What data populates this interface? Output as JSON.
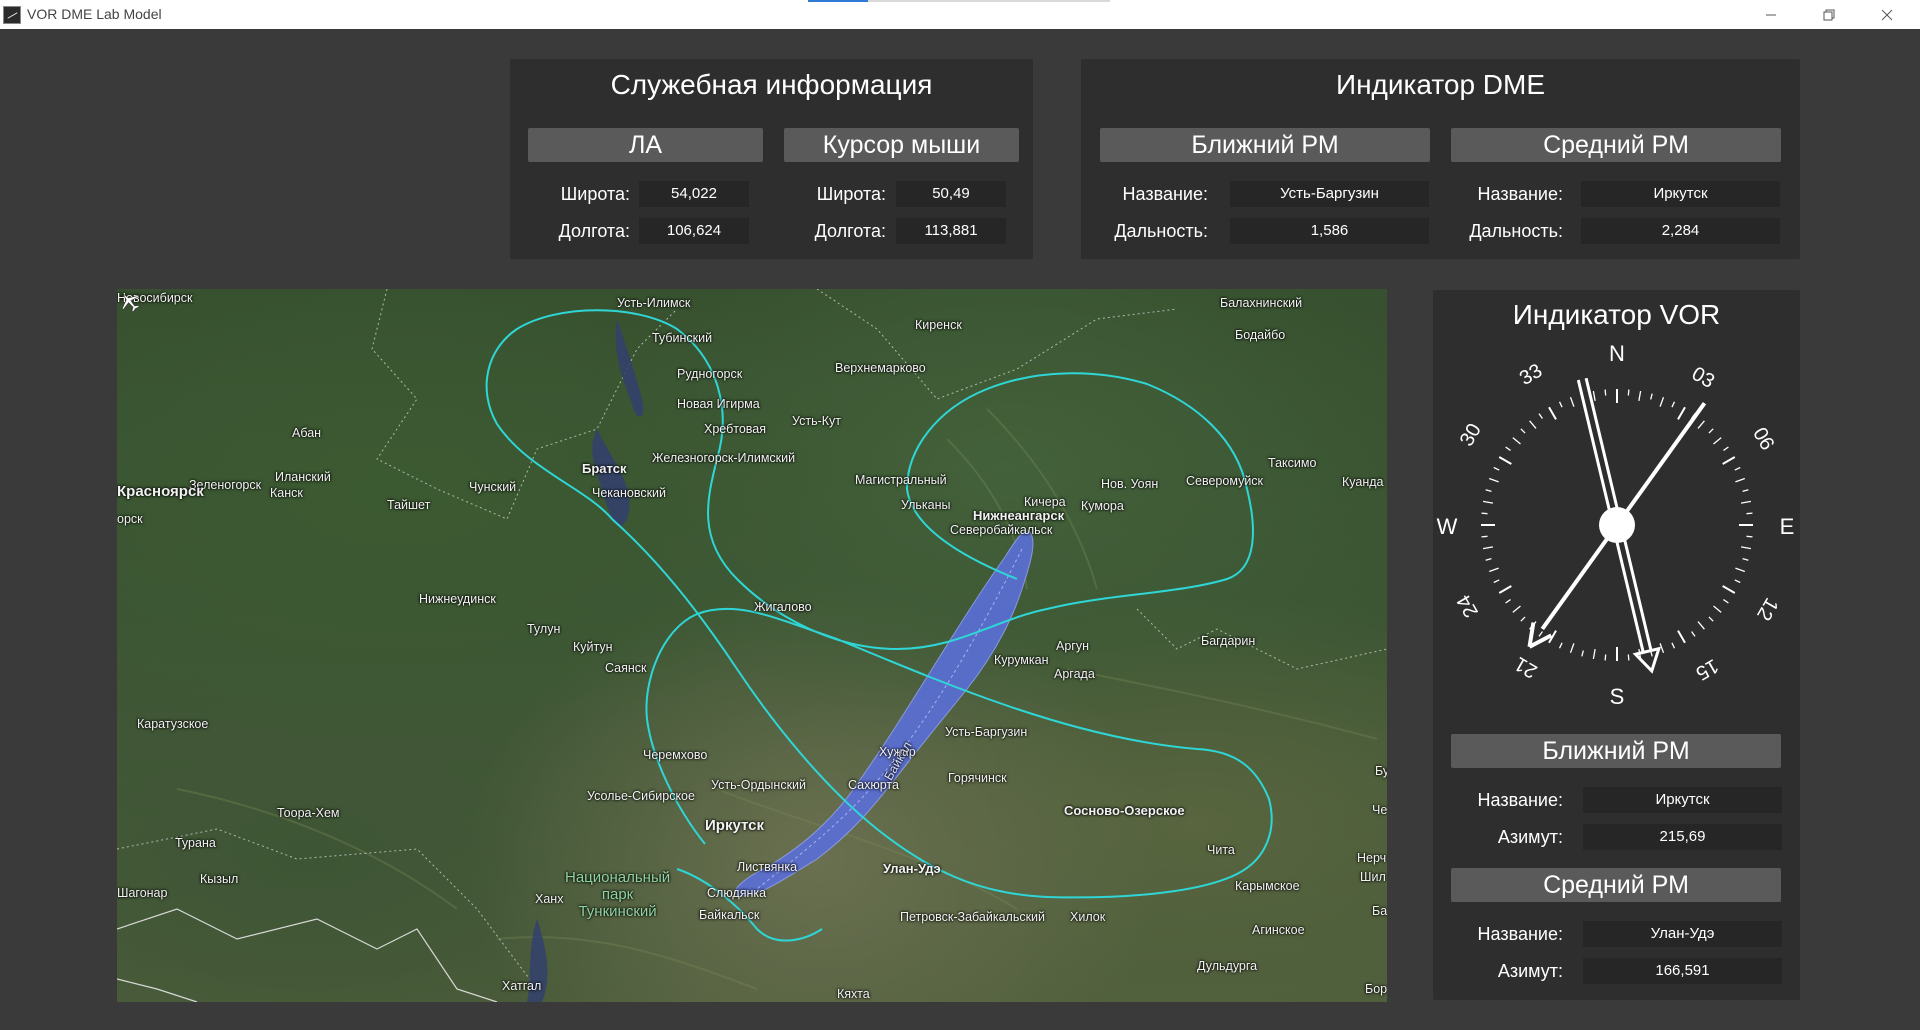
{
  "window": {
    "title": "VOR DME Lab Model",
    "minimize_icon": "minimize-icon",
    "restore_icon": "restore-icon",
    "close_icon": "close-icon"
  },
  "service_info": {
    "title": "Служебная информация",
    "aircraft": {
      "header": "ЛА",
      "lat_label": "Широта:",
      "lat": "54,022",
      "lon_label": "Долгота:",
      "lon": "106,624"
    },
    "cursor": {
      "header": "Курсор мыши",
      "lat_label": "Широта:",
      "lat": "50,49",
      "lon_label": "Долгота:",
      "lon": "113,881"
    }
  },
  "dme": {
    "title": "Индикатор DME",
    "near": {
      "header": "Ближний РМ",
      "name_label": "Название:",
      "name": "Усть-Баргузин",
      "dist_label": "Дальность:",
      "dist": "1,586"
    },
    "mid": {
      "header": "Средний РМ",
      "name_label": "Название:",
      "name": "Иркутск",
      "dist_label": "Дальность:",
      "dist": "2,284"
    }
  },
  "vor": {
    "title": "Индикатор VOR",
    "cardinals": {
      "n": "N",
      "e": "E",
      "s": "S",
      "w": "W"
    },
    "numbers": {
      "n03": "03",
      "n06": "06",
      "n12": "12",
      "n15": "15",
      "n21": "21",
      "n24": "24",
      "n30": "30",
      "n33": "33"
    },
    "near_bearing_deg": 166.591,
    "mid_bearing_deg": 215.69,
    "near": {
      "header": "Ближний РМ",
      "name_label": "Название:",
      "name": "Иркутск",
      "az_label": "Азимут:",
      "az": "215,69"
    },
    "mid": {
      "header": "Средний РМ",
      "name_label": "Название:",
      "name": "Улан-Удэ",
      "az_label": "Азимут:",
      "az": "166,591"
    }
  },
  "map": {
    "route_color": "#2fd6d6",
    "lake_color": "#5a6fd8",
    "aircraft_icon": "airplane-icon",
    "labels": {
      "c1": "Усть-Илимск",
      "c2": "Киренск",
      "c3": "Балахнинский",
      "c4": "Бодайбо",
      "c5": "Тубинский",
      "c6": "Рудногорск",
      "c7": "Верхнемарково",
      "c8": "Новая Игирма",
      "c9": "Хребтовая",
      "c10": "Усть-Кут",
      "c11": "Абан",
      "c12": "Братск",
      "c13": "Железногорск-Илимский",
      "c14": "Таксимо",
      "c15": "Иланский",
      "c16": "Зеленогорск",
      "c17": "Канск",
      "c18": "Чунский",
      "c19": "Чекановский",
      "c20": "Магистральный",
      "c21": "Нов. Уоян",
      "c22": "Северомуйск",
      "c23": "Куанда",
      "c24": "Тайшет",
      "c25": "Ульканы",
      "c26": "Кичера",
      "c27": "Нижнеангарск",
      "c28": "Кумора",
      "c29": "Северобайкальск",
      "c30": "Нижнеудинск",
      "c31": "Жигалово",
      "c32": "Тулун",
      "c33": "Куйтун",
      "c34": "Багдарин",
      "c35": "Аргун",
      "c36": "Саянск",
      "c37": "Курумкан",
      "c38": "Аргада",
      "c39": "Каратузское",
      "c40": "Усть-Баргузин",
      "c41": "Хужир",
      "c42": "Черемхово",
      "c43": "Усть-Ордынский",
      "c44": "Сахюрта",
      "c45": "Горячинск",
      "c46": "Усолье-Сибирское",
      "c47": "Сосново-Озерское",
      "c48": "Тоора-Хем",
      "c49": "Иркутск",
      "c50": "Турана",
      "c51": "Листвянка",
      "c52": "Улан-Удэ",
      "c53": "Чита",
      "c54": "Кызыл",
      "c55": "Национальный\nпарк\nТункинский",
      "c56": "Карымское",
      "c57": "Шагонар",
      "c58": "Ханх",
      "c59": "Слюдянка",
      "c60": "Байкальск",
      "c61": "Петровск-Забайкальский",
      "c62": "Хилок",
      "c63": "Агинское",
      "c64": "Дульдурга",
      "c65": "Хатгал",
      "c66": "Кяхта",
      "c67": "Красноярск",
      "c68": "Новосибирск",
      "c69": "орск",
      "c70": "Бу",
      "c71": "Че",
      "c72": "Нерч",
      "c73": "Шил",
      "c74": "Ба",
      "c75": "Бор",
      "c76": "Байкал"
    }
  }
}
